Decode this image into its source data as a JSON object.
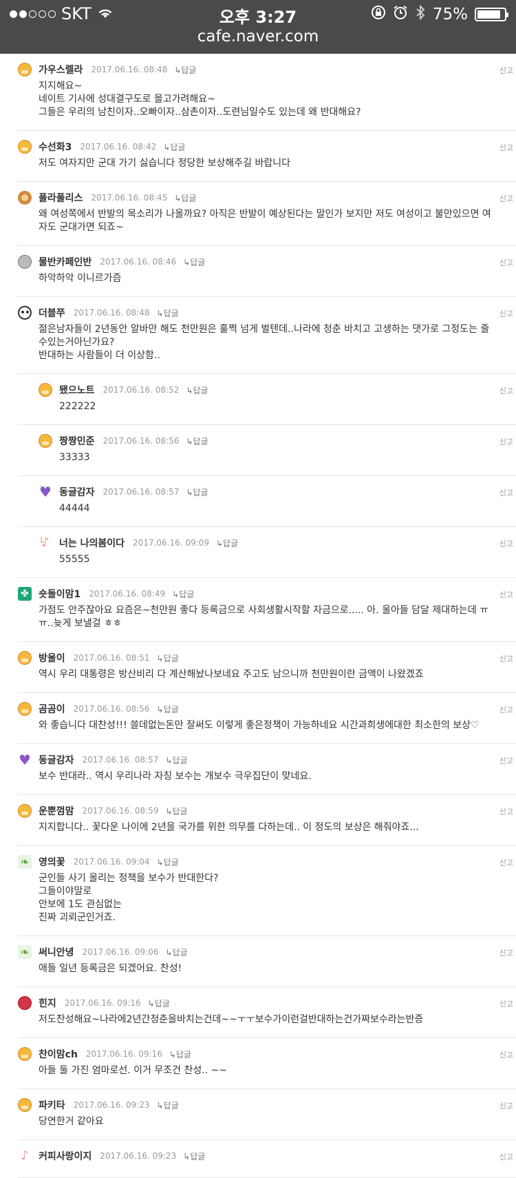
{
  "status_bar": {
    "carrier": "SKT",
    "time": "오후 3:27",
    "battery": "75%",
    "url": "cafe.naver.com"
  },
  "ui": {
    "reply_label": "↳답글",
    "report_label": "신고"
  },
  "comments": [
    {
      "nick": "가우스렐라",
      "date": "2017.06.16. 08:48",
      "text": "지지해요~\n네이트 기사에 성대결구도로 몰고가려해요~\n그들은 우리의 남친이자..오빠이자..삼촌이자..도련님일수도 있는데 왜 반대해요?",
      "avatar": "yellow"
    },
    {
      "nick": "수선화3",
      "date": "2017.06.16. 08:42",
      "text": "저도 여자지만 군대 가기 싫습니다 정당한 보상해주길 바랍니다",
      "avatar": "yellow"
    },
    {
      "nick": "폴라폴리스",
      "date": "2017.06.16. 08:45",
      "text": " 왜 여성쪽에서 반발의 목소리가 나올까요? 아직은 반발이 예상된다는 말인가 보지만 저도 여성이고 불만있으면 여자도 군대가면 되죠~",
      "avatar": "dog"
    },
    {
      "nick": "물반카페인반",
      "date": "2017.06.16. 08:46",
      "text": "하악하악 이니르가즘",
      "avatar": "grey"
    },
    {
      "nick": "더블쭈",
      "date": "2017.06.16. 08:48",
      "text": "젊은남자들이 2년동안 알바만 해도 천만원은 훌쩍 넘게 벌텐데..나라에 청춘 바치고 고생하는 댓가로 그정도는 줄수있는거아닌가요?\n반대하는 사람들이 더 이상함..",
      "avatar": "panda"
    },
    {
      "nick": "됐으노트",
      "date": "2017.06.16. 08:52",
      "text": "222222",
      "avatar": "yellow",
      "reply": true
    },
    {
      "nick": "짱짱민준",
      "date": "2017.06.16. 08:56",
      "text": "33333",
      "avatar": "yellow",
      "reply": true
    },
    {
      "nick": "동글감자",
      "date": "2017.06.16. 08:57",
      "text": "44444",
      "avatar": "heart",
      "reply": true
    },
    {
      "nick": "너는 나의봄이다",
      "date": "2017.06.16. 09:09",
      "text": "55555",
      "avatar": "pink",
      "reply": true
    },
    {
      "nick": "숏돌이맘1",
      "date": "2017.06.16. 08:49",
      "text": "가점도 안주잖아요 요즘은~천만원 좋다 등록금으로 사회생활시작할 자금으로..... 아. 울아들 담달 제대하는데 ㅠㅠ..늦게 보낼걸 ㅎㅎ",
      "avatar": "clover"
    },
    {
      "nick": "방울이",
      "date": "2017.06.16. 08:51",
      "text": "역시 우리 대통령은 방산비리 다 계산해놨나보네요 주고도 남으니까 천만원이란 금액이 나왔겠죠",
      "avatar": "yellow"
    },
    {
      "nick": "곰곰이",
      "date": "2017.06.16. 08:56",
      "text": "와 좋습니다 대찬성!!! 쓸데없는돈만 잘써도 이렇게 좋은정책이 가능하네요 시간과희생에대한 최소한의 보상♡",
      "avatar": "yellow"
    },
    {
      "nick": "동글감자",
      "date": "2017.06.16. 08:57",
      "text": "보수 반대라.. 역시 우리나라 자칭 보수는 개보수 극우집단이 맞네요.",
      "avatar": "heart"
    },
    {
      "nick": "운뿐껌맘",
      "date": "2017.06.16. 08:59",
      "text": "지지합니다.. 꽃다운 나이에 2년을 국가를 위한 의무를 다하는데.. 이 정도의 보상은 해줘야죠...",
      "avatar": "yellow"
    },
    {
      "nick": "영의꽃",
      "date": "2017.06.16. 09:04",
      "text": "군인들 사기 올리는 정책을 보수가 반대한다?\n그들이야말로\n안보에 1도 관심없는\n진짜 괴뢰군인거죠.",
      "avatar": "leaf"
    },
    {
      "nick": "써니안녕",
      "date": "2017.06.16. 09:06",
      "text": "애들 일년 등록금은 되겠어요. 찬성!",
      "avatar": "leaf"
    },
    {
      "nick": "힌지",
      "date": "2017.06.16. 09:16",
      "text": "저도찬성해요~나라에2년간청춘을바치는건데~~ㅜㅜ보수가이런걸반대하는건가짜보수라는반증",
      "avatar": "red"
    },
    {
      "nick": "찬이맘ch",
      "date": "2017.06.16. 09:16",
      "text": "아들 둘 가진 엄마로선. 이거 무조건 찬성.. ~~",
      "avatar": "yellow"
    },
    {
      "nick": "파키타",
      "date": "2017.06.16. 09:23",
      "text": "당연한거 같아요",
      "avatar": "yellow"
    },
    {
      "nick": "커피사랑이지",
      "date": "2017.06.16. 09:23",
      "text": "",
      "avatar": "pink"
    }
  ]
}
